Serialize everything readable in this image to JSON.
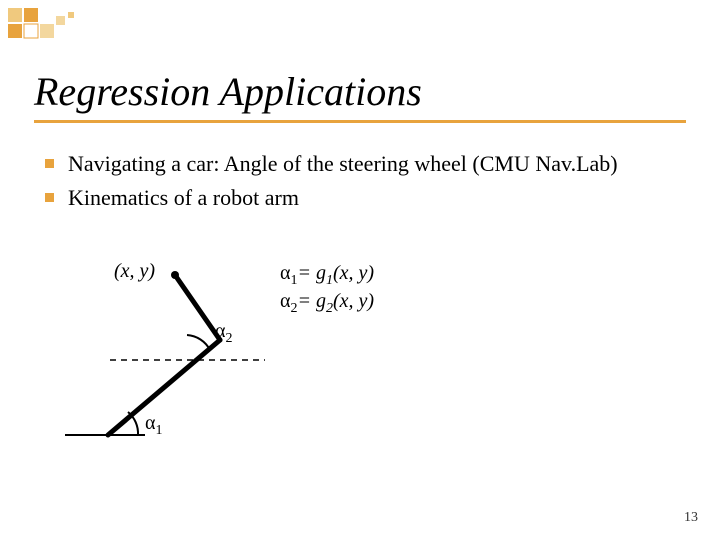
{
  "title": "Regression Applications",
  "bullets": [
    "Navigating a car: Angle of the steering wheel (CMU Nav.Lab)",
    "Kinematics of a robot arm"
  ],
  "diagram": {
    "xy": "(x, y)",
    "alpha1": "α",
    "alpha1_sub": "1",
    "alpha2": "α",
    "alpha2_sub": "2",
    "eq1_left": "α",
    "eq1_sub": "1",
    "eq1_right": "= g",
    "eq1_gsub": "1",
    "eq1_args": "(x, y)",
    "eq2_left": "α",
    "eq2_sub": "2",
    "eq2_right": "= g",
    "eq2_gsub": "2",
    "eq2_args": "(x, y)"
  },
  "page_number": "13"
}
